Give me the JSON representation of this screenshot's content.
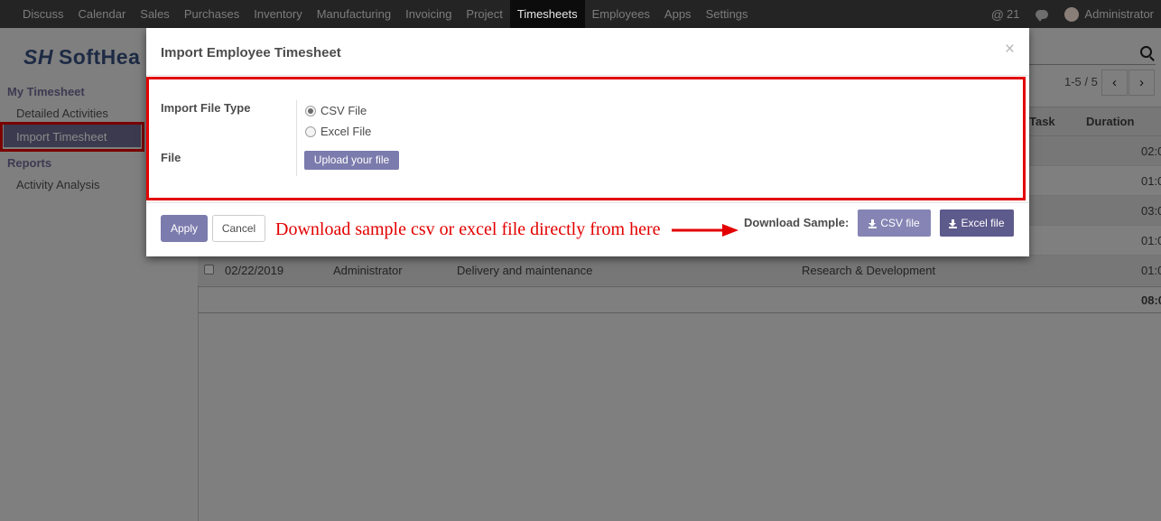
{
  "navbar": {
    "menu": [
      "Discuss",
      "Calendar",
      "Sales",
      "Purchases",
      "Inventory",
      "Manufacturing",
      "Invoicing",
      "Project",
      "Timesheets",
      "Employees",
      "Apps",
      "Settings"
    ],
    "active": "Timesheets",
    "mentions_count": "21",
    "user": "Administrator"
  },
  "logo": {
    "mark": "SH",
    "text": "SoftHea"
  },
  "sidebar": {
    "section1": "My Timesheet",
    "item1": "Detailed Activities",
    "item2": "Import Timesheet",
    "section2": "Reports",
    "item3": "Activity Analysis"
  },
  "pager": {
    "text": "1-5 / 5",
    "prev": "‹",
    "next": "›"
  },
  "table": {
    "headers": {
      "task": "Task",
      "duration": "Duration"
    },
    "durations": [
      "02:0",
      "01:0",
      "03:0",
      "01:0",
      "01:0"
    ],
    "last_row": {
      "date": "02/22/2019",
      "user": "Administrator",
      "description": "Delivery and maintenance",
      "project": "Research & Development",
      "duration": "01:0"
    },
    "total": "08:0"
  },
  "modal": {
    "title": "Import Employee Timesheet",
    "close": "×",
    "file_type_label": "Import File Type",
    "option_csv": "CSV File",
    "option_excel": "Excel File",
    "selected": "CSV File",
    "file_label": "File",
    "upload_label": "Upload your file",
    "apply_label": "Apply",
    "cancel_label": "Cancel",
    "annotation": "Download sample csv or excel file directly from here",
    "download_label": "Download Sample:",
    "csv_btn": "CSV file",
    "excel_btn": "Excel file"
  },
  "colors": {
    "accent": "#7c7bad",
    "highlight": "#e30000",
    "navbar": "#242424"
  }
}
